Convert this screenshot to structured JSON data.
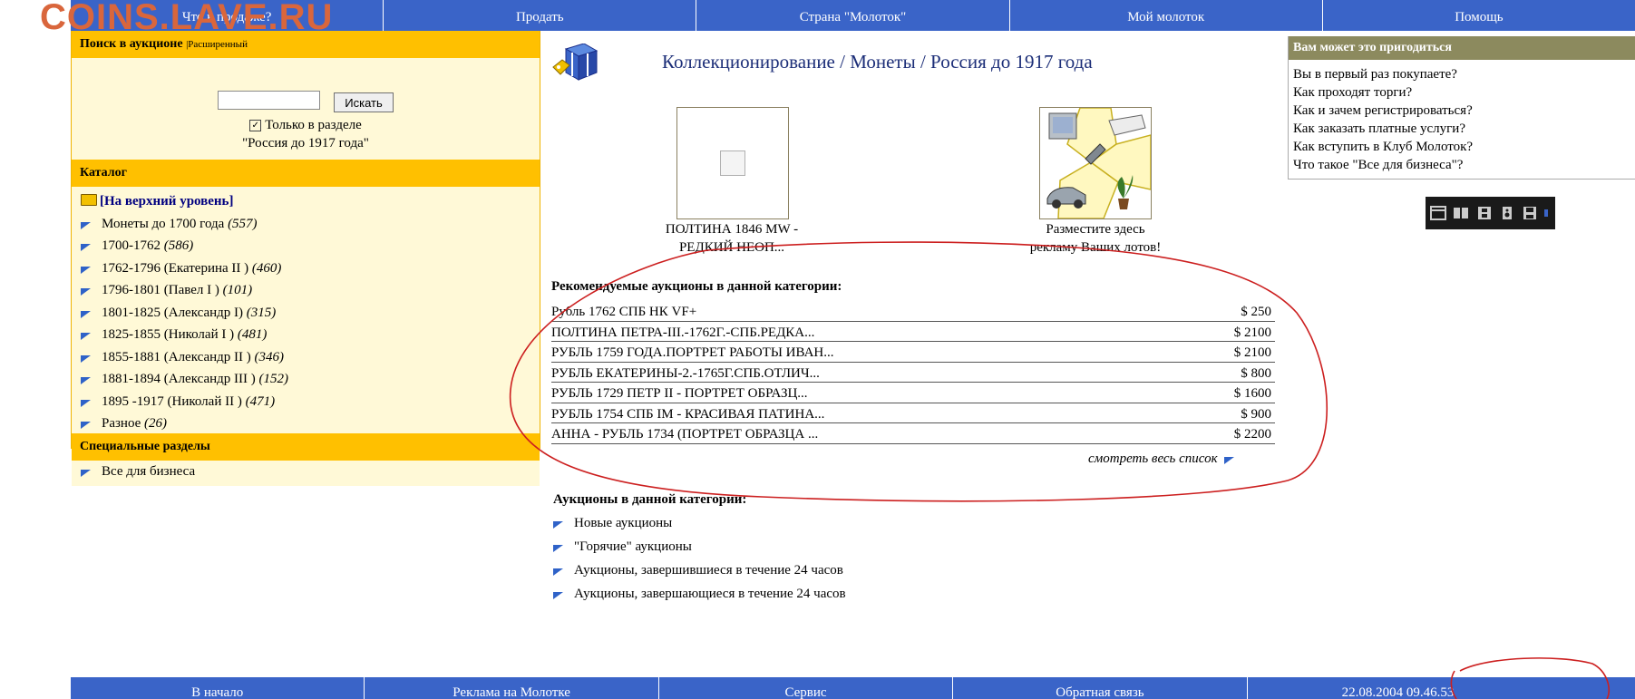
{
  "watermark": "COINS.LAVE.RU",
  "top_nav": [
    "Что в продаже?",
    "Продать",
    "Страна \"Молоток\"",
    "Мой молоток",
    "Помощь"
  ],
  "search": {
    "title": "Поиск в аукционе",
    "advanced": "Расширенный",
    "input_value": "",
    "button": "Искать",
    "only_section": "Только в разделе",
    "section_name": "\"Россия до 1917 года\""
  },
  "catalog": {
    "title": "Каталог",
    "top_level": "[На верхний уровень]",
    "items": [
      {
        "label": "Монеты до 1700 года",
        "count": "(557)"
      },
      {
        "label": "1700-1762",
        "count": "(586)"
      },
      {
        "label": "1762-1796 (Екатерина II )",
        "count": "(460)"
      },
      {
        "label": "1796-1801 (Павел I )",
        "count": "(101)"
      },
      {
        "label": "1801-1825 (Александр I)",
        "count": "(315)"
      },
      {
        "label": "1825-1855 (Николай I )",
        "count": "(481)"
      },
      {
        "label": "1855-1881 (Александр II )",
        "count": "(346)"
      },
      {
        "label": "1881-1894 (Александр III )",
        "count": "(152)"
      },
      {
        "label": "1895 -1917 (Николай II )",
        "count": "(471)"
      },
      {
        "label": "Разное",
        "count": "(26)"
      }
    ]
  },
  "special": {
    "title": "Специальные разделы",
    "items": [
      "Все для бизнеса"
    ]
  },
  "breadcrumb": "Коллекционирование / Монеты / Россия до 1917 года",
  "featured": {
    "lot_caption_1": "ПОЛТИНА 1846 MW -",
    "lot_caption_2": "РЕДКИЙ НЕОП...",
    "ad_caption_1": "Разместите здесь",
    "ad_caption_2": "рекламу Ваших лотов!"
  },
  "recommended": {
    "title": "Рекомендуемые аукционы в данной категории:",
    "rows": [
      {
        "name": "Рубль 1762 СПБ НК VF+",
        "price": "$ 250"
      },
      {
        "name": "ПОЛТИНА ПЕТРА-III.-1762Г.-СПБ.РЕДКА...",
        "price": "$ 2100"
      },
      {
        "name": "РУБЛЬ 1759 ГОДА.ПОРТРЕТ РАБОТЫ ИВАН...",
        "price": "$ 2100"
      },
      {
        "name": "РУБЛЬ ЕКАТЕРИНЫ-2.-1765Г.СПБ.ОТЛИЧ...",
        "price": "$ 800"
      },
      {
        "name": "РУБЛЬ 1729 ПЕТР II - ПОРТРЕТ ОБРАЗЦ...",
        "price": "$ 1600"
      },
      {
        "name": "РУБЛЬ 1754 СПБ IM - КРАСИВАЯ ПАТИНА...",
        "price": "$ 900"
      },
      {
        "name": "АННА - РУБЛЬ 1734 (ПОРТРЕТ ОБРАЗЦА ...",
        "price": "$ 2200"
      }
    ],
    "see_all": "смотреть весь список"
  },
  "category_auctions": {
    "title": "Аукционы в данной категории:",
    "items": [
      "Новые аукционы",
      "\"Горячие\" аукционы",
      "Аукционы, завершившиеся в течение 24 часов",
      "Аукционы, завершающиеся в течение 24 часов"
    ]
  },
  "help": {
    "title": "Вам может это пригодиться",
    "items": [
      "Вы в первый раз покупаете?",
      "Как проходят торги?",
      "Как и зачем регистрироваться?",
      "Как заказать платные услуги?",
      "Как вступить в Клуб Молоток?",
      "Что такое \"Все для бизнеса\"?"
    ]
  },
  "bottom_nav": [
    "В начало",
    "Реклама на Молотке",
    "Сервис",
    "Обратная связь",
    "22.08.2004 09.46.53"
  ],
  "colors": {
    "nav_blue": "#3a64c8",
    "panel_yellow": "#ffc000",
    "annotation_red": "#cc1f1f"
  }
}
